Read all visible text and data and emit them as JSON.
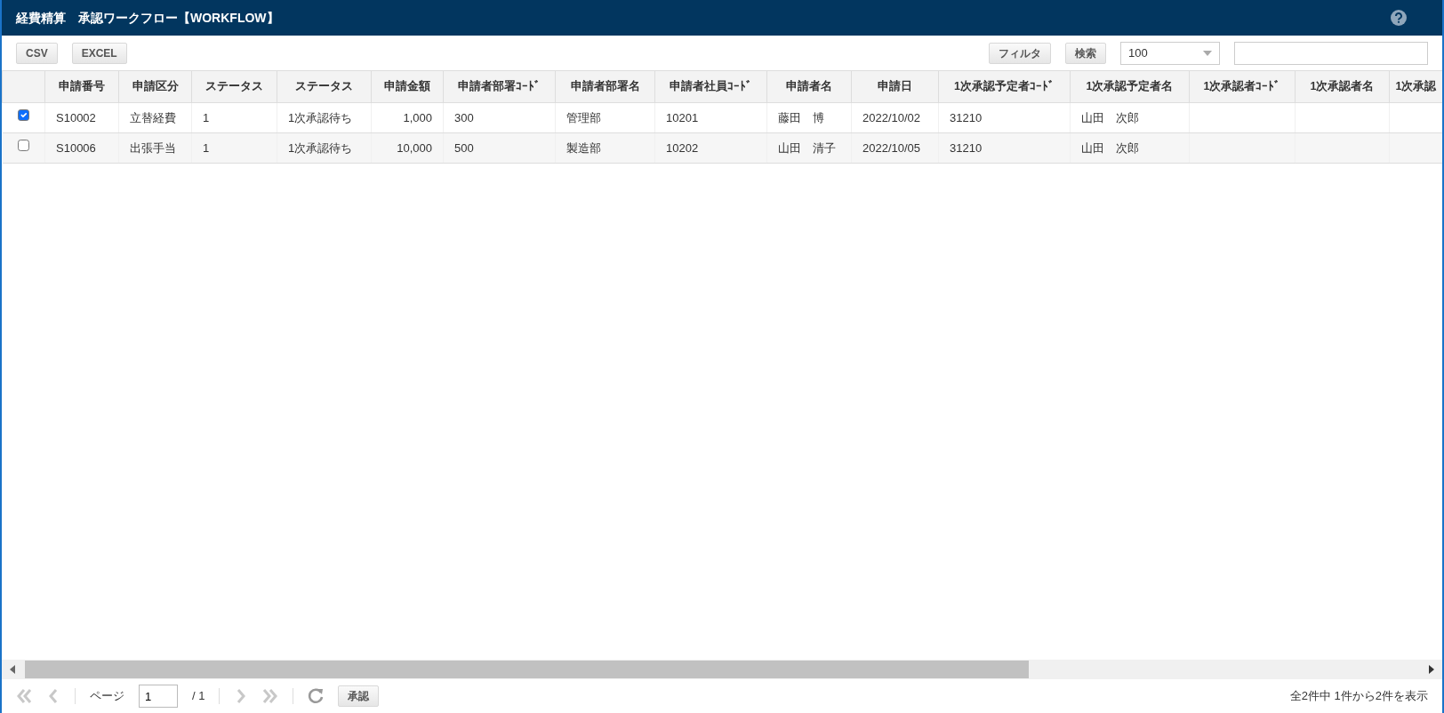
{
  "window": {
    "title": "経費精算　承認ワークフロー【WORKFLOW】"
  },
  "toolbar": {
    "left_buttons": [
      "CSV",
      "EXCEL"
    ],
    "right_buttons": [
      "フィルタ",
      "検索"
    ],
    "page_size": "100"
  },
  "table": {
    "columns": [
      {
        "label": "申請番号",
        "kind": "text"
      },
      {
        "label": "申請区分",
        "kind": "text"
      },
      {
        "label": "ステータス",
        "kind": "text"
      },
      {
        "label": "ステータス",
        "kind": "text"
      },
      {
        "label": "申請金額",
        "kind": "number"
      },
      {
        "label": "申請者部署ｺｰﾄﾞ",
        "kind": "text"
      },
      {
        "label": "申請者部署名",
        "kind": "text"
      },
      {
        "label": "申請者社員ｺｰﾄﾞ",
        "kind": "text"
      },
      {
        "label": "申請者名",
        "kind": "text"
      },
      {
        "label": "申請日",
        "kind": "text"
      },
      {
        "label": "1次承認予定者ｺｰﾄﾞ",
        "kind": "text"
      },
      {
        "label": "1次承認予定者名",
        "kind": "text"
      },
      {
        "label": "1次承認者ｺｰﾄﾞ",
        "kind": "text"
      },
      {
        "label": "1次承認者名",
        "kind": "text"
      },
      {
        "label": "1次承認",
        "kind": "text"
      }
    ],
    "rows": [
      {
        "checked": true,
        "cells": [
          "S10002",
          "立替経費",
          "1",
          "1次承認待ち",
          "1,000",
          "300",
          "管理部",
          "10201",
          "藤田　博",
          "2022/10/02",
          "31210",
          "山田　次郎"
        ]
      },
      {
        "checked": false,
        "cells": [
          "S10006",
          "出張手当",
          "1",
          "1次承認待ち",
          "10,000",
          "500",
          "製造部",
          "10202",
          "山田　清子",
          "2022/10/05",
          "31210",
          "山田　次郎"
        ]
      }
    ]
  },
  "pager": {
    "label": "ページ",
    "page": "1",
    "total": "/ 1",
    "action_button": "承認",
    "summary": "全2件中 1件から2件を表示"
  }
}
